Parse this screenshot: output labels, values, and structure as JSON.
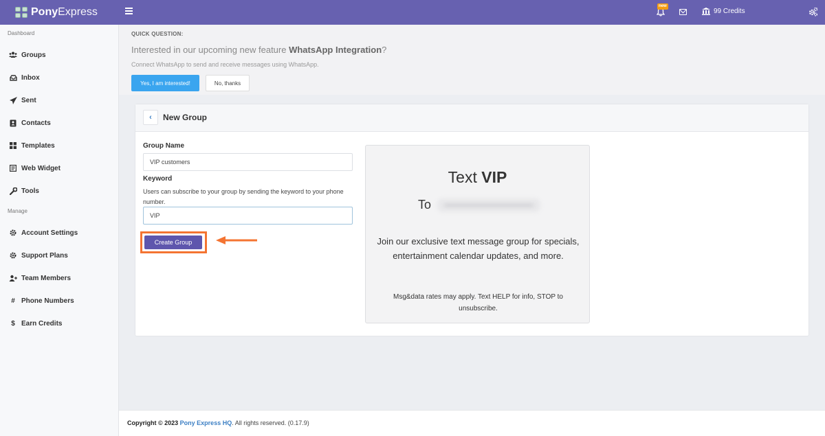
{
  "topbar": {
    "brand_bold": "Pony",
    "brand_light": "Express",
    "new_badge": "new",
    "credits": "99 Credits"
  },
  "sidebar": {
    "section1": "Dashboard",
    "section2": "Manage",
    "items": [
      {
        "label": "Groups",
        "icon": "users-icon"
      },
      {
        "label": "Inbox",
        "icon": "inbox-icon"
      },
      {
        "label": "Sent",
        "icon": "paper-plane-icon"
      },
      {
        "label": "Contacts",
        "icon": "address-book-icon"
      },
      {
        "label": "Templates",
        "icon": "grid-icon"
      },
      {
        "label": "Web Widget",
        "icon": "widget-icon"
      },
      {
        "label": "Tools",
        "icon": "wrench-icon"
      },
      {
        "label": "Account Settings",
        "icon": "gear-icon"
      },
      {
        "label": "Support Plans",
        "icon": "gear-icon"
      },
      {
        "label": "Team Members",
        "icon": "user-plus-icon"
      },
      {
        "label": "Phone Numbers",
        "icon": "hash-icon"
      },
      {
        "label": "Earn Credits",
        "icon": "dollar-icon"
      }
    ]
  },
  "quick_question": {
    "label": "QUICK QUESTION:",
    "title_prefix": "Interested in our upcoming new feature ",
    "title_feature": "WhatsApp Integration",
    "title_suffix": "?",
    "description": "Connect WhatsApp to send and receive messages using WhatsApp.",
    "yes_label": "Yes, I am interested!",
    "no_label": "No, thanks"
  },
  "form": {
    "title": "New Group",
    "group_name_label": "Group Name",
    "group_name_value": "VIP customers",
    "keyword_label": "Keyword",
    "keyword_help": "Users can subscribe to your group by sending the keyword to your phone number.",
    "keyword_value": "VIP",
    "submit_label": "Create Group"
  },
  "preview": {
    "text_prefix": "Text ",
    "keyword": "VIP",
    "to_label": "To",
    "join_text": "Join our exclusive text message group for specials, entertainment calendar updates, and more.",
    "disclaimer": "Msg&data rates may apply. Text HELP for info, STOP to unsubscribe."
  },
  "footer": {
    "copyright": "Copyright © 2023",
    "company": "Pony Express HQ",
    "rest": ". All rights reserved. (0.17.9)"
  },
  "colors": {
    "topbar": "#6761b0",
    "primary_button": "#5e56ad",
    "info_button": "#3aa5ef",
    "highlight": "#f47432"
  }
}
